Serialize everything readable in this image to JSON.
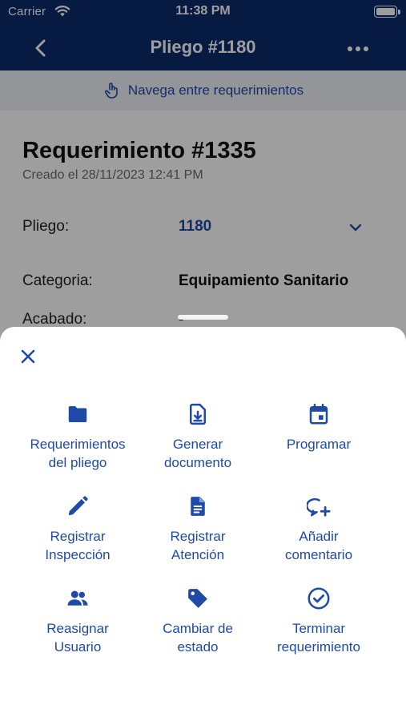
{
  "status_bar": {
    "carrier": "Carrier",
    "time": "11:38 PM"
  },
  "nav": {
    "title": "Pliego #1180",
    "back_icon": "chevron-left-icon",
    "more_icon": "ellipsis-icon"
  },
  "hint": {
    "text": "Navega entre requerimientos",
    "icon": "hand-pointer-icon"
  },
  "requirement": {
    "title": "Requerimiento #1335",
    "created": "Creado el 28/11/2023 12:41 PM",
    "fields": [
      {
        "label": "Pliego:",
        "value": "1180"
      },
      {
        "label": "Categoria:",
        "value": "Equipamiento Sanitario"
      },
      {
        "label": "Acabado:",
        "value": "-"
      }
    ]
  },
  "sheet": {
    "close_icon": "close-icon",
    "actions": [
      {
        "label_1": "Requerimientos",
        "label_2": "del pliego",
        "icon": "folder-icon"
      },
      {
        "label_1": "Generar",
        "label_2": "documento",
        "icon": "download-file-icon"
      },
      {
        "label_1": "Programar",
        "label_2": "",
        "icon": "calendar-icon"
      },
      {
        "label_1": "Registrar",
        "label_2": "Inspección",
        "icon": "pencil-icon"
      },
      {
        "label_1": "Registrar",
        "label_2": "Atención",
        "icon": "document-icon"
      },
      {
        "label_1": "Añadir",
        "label_2": "comentario",
        "icon": "add-comment-icon"
      },
      {
        "label_1": "Reasignar",
        "label_2": "Usuario",
        "icon": "users-icon"
      },
      {
        "label_1": "Cambiar de",
        "label_2": "estado",
        "icon": "tag-icon"
      },
      {
        "label_1": "Terminar",
        "label_2": "requerimiento",
        "icon": "check-circle-icon"
      }
    ]
  },
  "colors": {
    "nav_background": "#0a2a6b",
    "accent": "#1f4aa8",
    "hint_background": "#eef1f6"
  }
}
